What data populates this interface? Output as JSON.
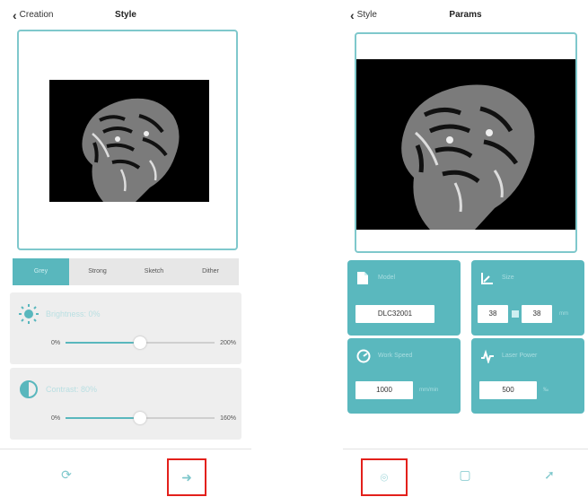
{
  "left": {
    "nav": {
      "back_label": "Creation",
      "title": "Style"
    },
    "tabs": [
      "Grey",
      "Strong",
      "Sketch",
      "Dither"
    ],
    "brightness": {
      "label": "Brightness: 0%",
      "min": "0%",
      "max": "200%",
      "value": 0.5
    },
    "contrast": {
      "label": "Contrast: 80%",
      "min": "0%",
      "max": "160%",
      "value": 0.5
    },
    "icons": {
      "rotate": "rotate-icon",
      "next": "next-icon"
    }
  },
  "right": {
    "nav": {
      "back_label": "Style",
      "title": "Params"
    },
    "params": {
      "model": {
        "label": "Model",
        "value": "DLC32001",
        "unit": ""
      },
      "size": {
        "label": "Size",
        "width": "38",
        "height": "38",
        "unit": "mm"
      },
      "speed": {
        "label": "Work Speed",
        "value": "1000",
        "unit": "mm/min"
      },
      "power": {
        "label": "Laser Power",
        "value": "500",
        "unit": "‰"
      }
    },
    "icons": {
      "preview": "preview-icon",
      "frame": "frame-icon",
      "send": "send-icon"
    }
  },
  "colors": {
    "accent": "#59b7bd",
    "highlight": "#e3201b"
  }
}
